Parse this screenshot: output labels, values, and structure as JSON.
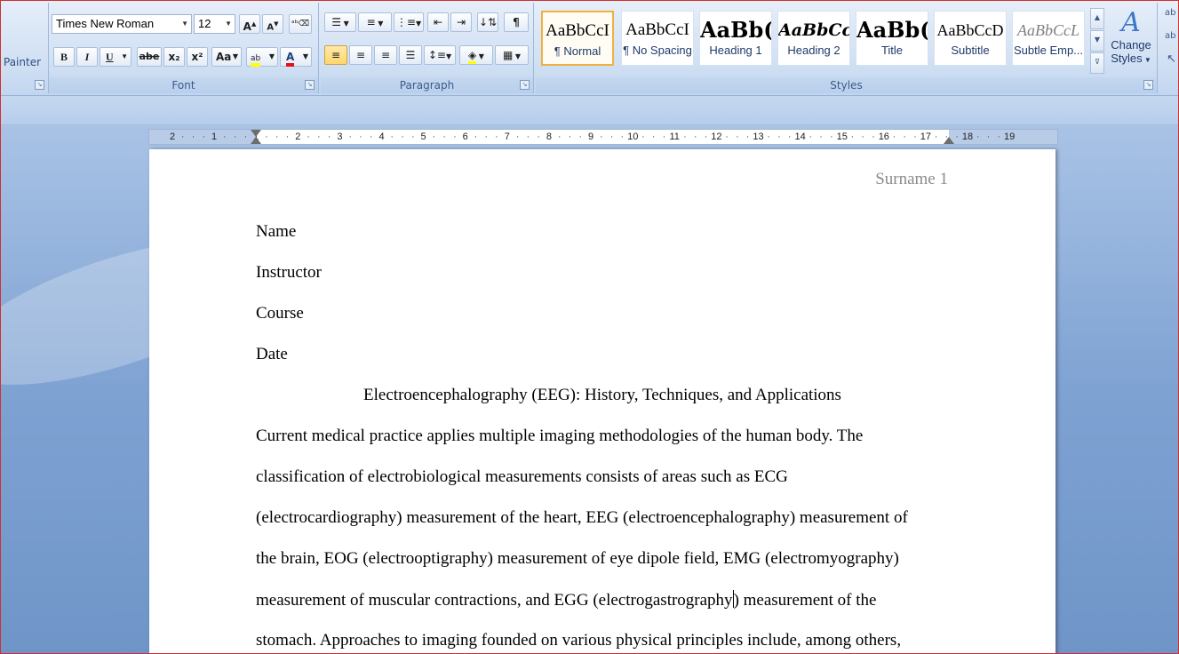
{
  "clipboard": {
    "painter_label": "Painter"
  },
  "font": {
    "group_label": "Font",
    "font_name": "Times New Roman",
    "font_size": "12",
    "grow_label": "A",
    "shrink_label": "A",
    "bold": "B",
    "italic": "I",
    "underline": "U",
    "strike": "abe",
    "subscript": "x₂",
    "superscript": "x²",
    "change_case": "Aa",
    "highlight_color": "#ffff00",
    "font_color": "#e81010"
  },
  "paragraph": {
    "group_label": "Paragraph",
    "pilcrow": "¶"
  },
  "styles": {
    "group_label": "Styles",
    "items": [
      {
        "sample": "AaBbCcI",
        "name": "¶ Normal"
      },
      {
        "sample": "AaBbCcI",
        "name": "¶ No Spacing"
      },
      {
        "sample": "AaBb(",
        "name": "Heading 1"
      },
      {
        "sample": "AaBbCc",
        "name": "Heading 2"
      },
      {
        "sample": "AaBb(",
        "name": "Title"
      },
      {
        "sample": "AaBbCcD",
        "name": "Subtitle"
      },
      {
        "sample": "AaBbCcL",
        "name": "Subtle Emp..."
      }
    ],
    "change_styles_line1": "Change",
    "change_styles_line2": "Styles"
  },
  "ruler": {
    "labels": [
      "2",
      "1",
      "1",
      "2",
      "3",
      "4",
      "5",
      "6",
      "7",
      "8",
      "9",
      "10",
      "11",
      "12",
      "13",
      "14",
      "15",
      "16",
      "17",
      "18",
      "19"
    ]
  },
  "document": {
    "header": "Surname 1",
    "lines": [
      "Name",
      "Instructor",
      "Course",
      "Date"
    ],
    "title": "Electroencephalography (EEG): History, Techniques, and Applications",
    "body": [
      "Current medical practice applies multiple imaging methodologies of the human body. The",
      "classification of electrobiological measurements consists of areas such as ECG",
      "(electrocardiography) measurement of the heart, EEG (electroencephalography) measurement of",
      "the brain, EOG (electrooptigraphy) measurement of eye dipole field, EMG (electromyography)",
      "measurement of muscular contractions, and EGG (electrogastrography",
      "stomach. Approaches to imaging founded on various physical principles include, among others,"
    ],
    "caret_line_tail": ") measurement of the"
  }
}
